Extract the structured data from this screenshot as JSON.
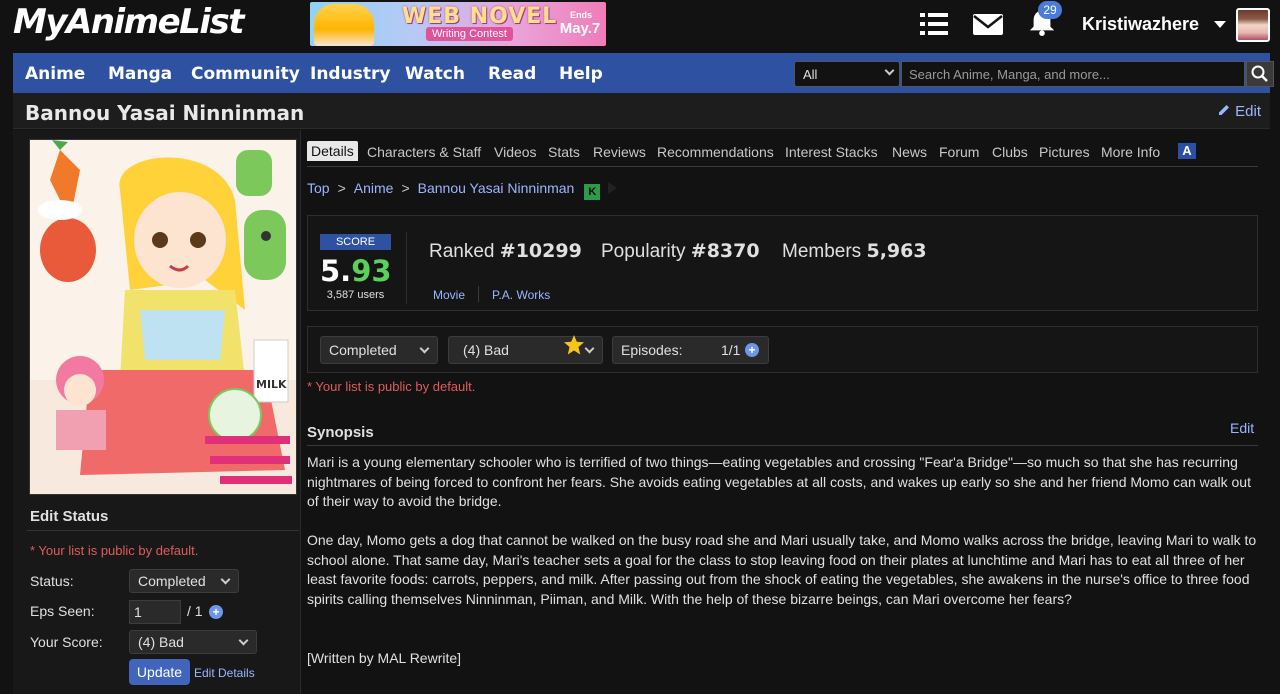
{
  "header": {
    "logo": "MyAnimeList",
    "banner": {
      "title": "WEB NOVEL",
      "subtitle": "Writing Contest",
      "ends_label": "Ends",
      "ends_date": "May.7"
    },
    "notifications_count": "29",
    "username": "Kristiwazhere"
  },
  "nav": {
    "items": [
      "Anime",
      "Manga",
      "Community",
      "Industry",
      "Watch",
      "Read",
      "Help"
    ],
    "search_category": "All",
    "search_placeholder": "Search Anime, Manga, and more..."
  },
  "page": {
    "title": "Bannou Yasai Ninninman",
    "edit_label": "Edit"
  },
  "edit_status": {
    "title": "Edit Status",
    "public_note": "* Your list is public by default.",
    "status_label": "Status:",
    "status_value": "Completed",
    "eps_label": "Eps Seen:",
    "eps_value": "1",
    "eps_total": "/ 1",
    "score_label": "Your Score:",
    "score_value": "(4) Bad",
    "update_label": "Update",
    "edit_details_label": "Edit Details"
  },
  "tabs": [
    "Details",
    "Characters & Staff",
    "Videos",
    "Stats",
    "Reviews",
    "Recommendations",
    "Interest Stacks",
    "News",
    "Forum",
    "Clubs",
    "Pictures",
    "More Info"
  ],
  "breadcrumb": [
    "Top",
    "Anime",
    "Bannou Yasai Ninninman"
  ],
  "breadcrumb_badge": "K",
  "stats": {
    "score_label": "SCORE",
    "score_int": "5.",
    "score_dec": "93",
    "score_users": "3,587 users",
    "ranked_label": "Ranked",
    "ranked_value": "#10299",
    "popularity_label": "Popularity",
    "popularity_value": "#8370",
    "members_label": "Members",
    "members_value": "5,963",
    "type": "Movie",
    "studio": "P.A. Works"
  },
  "list_status": {
    "status": "Completed",
    "score": "(4) Bad",
    "episodes_label": "Episodes:",
    "episodes_value": "1/1",
    "public_note": "* Your list is public by default."
  },
  "synopsis": {
    "title": "Synopsis",
    "edit_label": "Edit",
    "p1": "Mari is a young elementary schooler who is terrified of two things—eating vegetables and crossing \"Fear'a Bridge\"—so much so that she has recurring nightmares of being forced to confront her fears. She avoids eating vegetables at all costs, and wakes up early so she and her friend Momo can walk out of their way to avoid the bridge.",
    "p2": "One day, Momo gets a dog that cannot be walked on the busy road she and Mari usually take, and Momo walks across the bridge, leaving Mari to walk to school alone. That same day, Mari's teacher sets a goal for the class to stop leaving food on their plates at lunchtime and Mari has to eat all three of her least favorite foods: carrots, peppers, and milk. After passing out from the shock of eating the vegetables, she awakens in the nurse's office to three food spirits calling themselves Ninninman, Piiman, and Milk. With the help of these bizarre beings, can Mari overcome her fears?",
    "p3": "[Written by MAL Rewrite]"
  },
  "colors": {
    "nav_bg": "#2e51a2",
    "link": "#9ab6ff",
    "score_green": "#5ad15a",
    "note_red": "#e05c5c"
  }
}
